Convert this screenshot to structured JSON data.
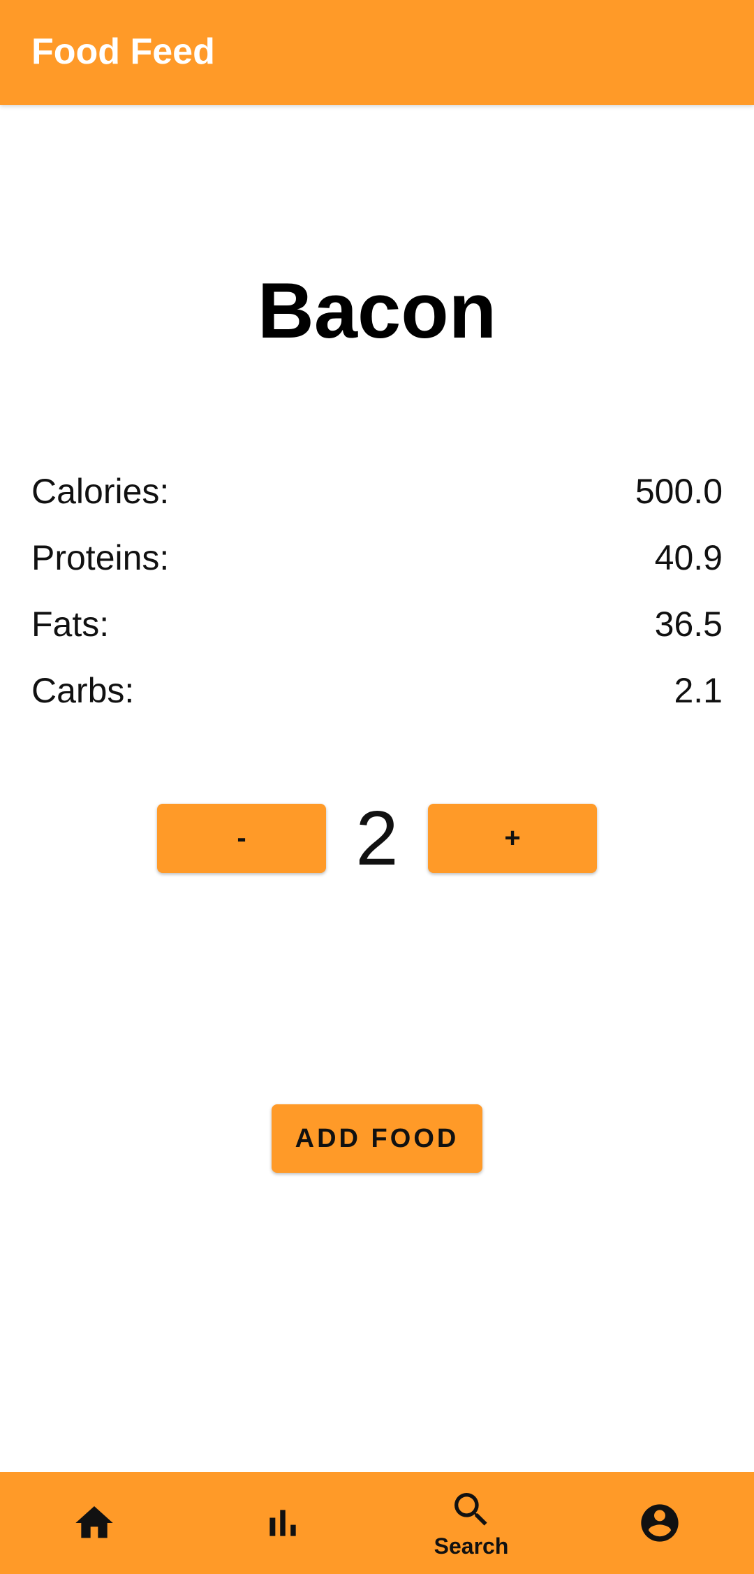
{
  "app_bar": {
    "title": "Food Feed"
  },
  "food": {
    "name": "Bacon",
    "nutrients": [
      {
        "label": "Calories:",
        "value": "500.0"
      },
      {
        "label": "Proteins:",
        "value": "40.9"
      },
      {
        "label": "Fats:",
        "value": "36.5"
      },
      {
        "label": "Carbs:",
        "value": "2.1"
      }
    ]
  },
  "stepper": {
    "minus_label": "-",
    "quantity": "2",
    "plus_label": "+"
  },
  "add_button_label": "ADD FOOD",
  "bottom_nav": {
    "items": [
      {
        "icon": "home-icon",
        "label": ""
      },
      {
        "icon": "bar-chart-icon",
        "label": ""
      },
      {
        "icon": "search-icon",
        "label": "Search",
        "selected": true
      },
      {
        "icon": "account-icon",
        "label": ""
      }
    ]
  },
  "colors": {
    "accent": "#FF9A28",
    "app_bar_text": "#FFFFFF",
    "text": "#111111"
  }
}
